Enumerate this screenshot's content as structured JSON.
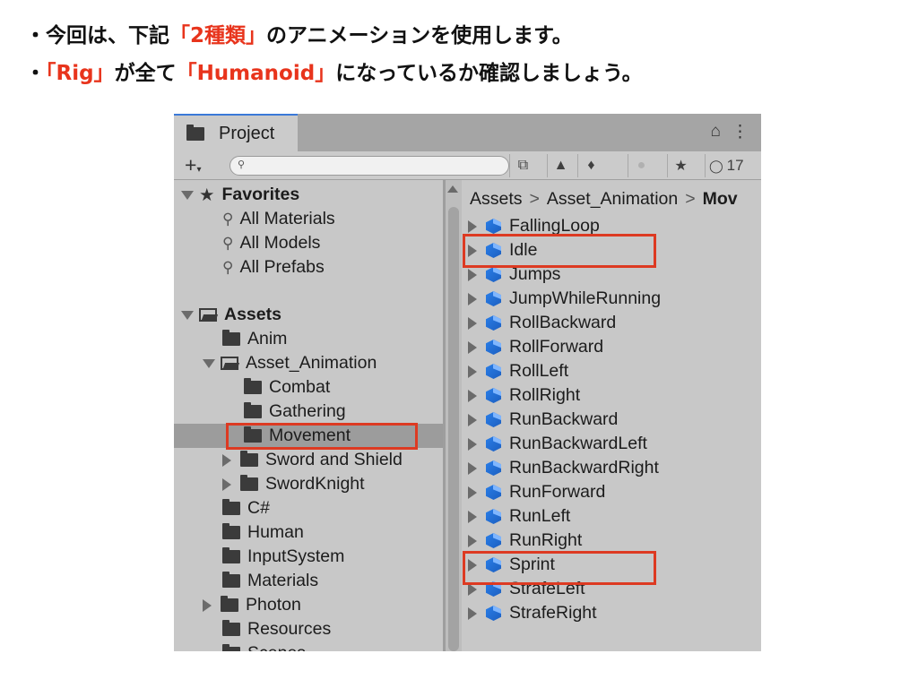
{
  "bullets": {
    "b1_dot": "・",
    "b1_pre": "今回は、下記",
    "b1_hl": "「2種類」",
    "b1_post": "のアニメーションを使用します。",
    "b2_dot": "・",
    "b2_hl1": "「Rig」",
    "b2_mid": "が全て",
    "b2_hl2": "「Humanoid」",
    "b2_post": "になっているか確認しましょう。"
  },
  "colors": {
    "highlight": "#e8341c",
    "box": "#dd3a22",
    "tab_accent": "#3a79d8"
  },
  "window": {
    "tab_label": "Project",
    "lock_glyph": "⌂",
    "menu_glyph": "⋮",
    "plus_label": "+",
    "plus_caret": "▾",
    "search_placeholder": "",
    "visible_count": "17"
  },
  "favorites": {
    "label": "Favorites",
    "items": [
      "All Materials",
      "All Models",
      "All Prefabs"
    ]
  },
  "assets": {
    "label": "Assets",
    "items": [
      "Anim",
      "Asset_Animation",
      "Combat",
      "Gathering",
      "Movement",
      "Sword and Shield",
      "SwordKnight",
      "C#",
      "Human",
      "InputSystem",
      "Materials",
      "Photon",
      "Resources",
      "Scenes"
    ]
  },
  "breadcrumb": [
    "Assets",
    "Asset_Animation",
    "Mov"
  ],
  "breadcrumb_sep": ">",
  "files": [
    "FallingLoop",
    "Idle",
    "Jumps",
    "JumpWhileRunning",
    "RollBackward",
    "RollForward",
    "RollLeft",
    "RollRight",
    "RunBackward",
    "RunBackwardLeft",
    "RunBackwardRight",
    "RunForward",
    "RunLeft",
    "RunRight",
    "Sprint",
    "StrafeLeft",
    "StrafeRight"
  ]
}
